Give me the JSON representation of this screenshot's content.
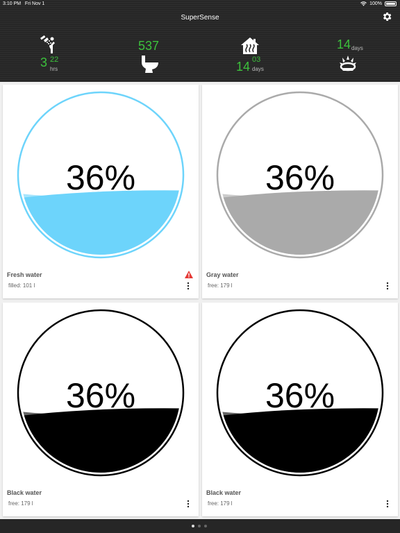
{
  "status_bar": {
    "time": "3:10 PM",
    "date": "Fri Nov 1",
    "battery": "100%"
  },
  "app": {
    "title": "SuperSense"
  },
  "stats": {
    "shower": {
      "icon": "shower-icon",
      "value": "3",
      "minutes": "22",
      "unit": "hrs"
    },
    "toilet": {
      "icon": "toilet-icon",
      "value": "537"
    },
    "heating": {
      "icon": "house-heating-icon",
      "value": "14",
      "sub": "03",
      "unit": "days"
    },
    "gas": {
      "icon": "gas-burner-icon",
      "value": "14",
      "unit": "days"
    }
  },
  "tanks": [
    {
      "name": "Fresh water",
      "percent": "36%",
      "level": 0.36,
      "detail": "filled: 101 l",
      "warning": true,
      "color": "#6dd4fb",
      "ring": "#6dd4fb"
    },
    {
      "name": "Gray water",
      "percent": "36%",
      "level": 0.36,
      "detail": "free: 179 l",
      "warning": false,
      "color": "#aaaaaa",
      "ring": "#aaaaaa"
    },
    {
      "name": "Black water",
      "percent": "36%",
      "level": 0.36,
      "detail": "free: 179 l",
      "warning": false,
      "color": "#000000",
      "ring": "#000000"
    },
    {
      "name": "Black water",
      "percent": "36%",
      "level": 0.36,
      "detail": "free: 179 l",
      "warning": false,
      "color": "#000000",
      "ring": "#000000"
    }
  ],
  "pager": {
    "count": 3,
    "active": 0
  }
}
